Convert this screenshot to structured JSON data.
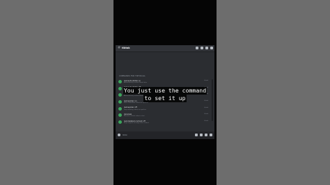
{
  "app": {
    "channel": "tiktok",
    "section_title": "COMMANDS FOR TIKTOK.GG",
    "commands": [
      {
        "name": "/set-auto-tiktok on",
        "desc": "Automatically embed tiktok links",
        "tag": "tiktok"
      },
      {
        "name": "/set-auto-tiktok off",
        "desc": "Stop embedding tiktok links",
        "tag": "tiktok"
      },
      {
        "name": "/set-auto-tiktok on",
        "desc": "Automatically embed tiktok links",
        "tag": "tiktok"
      },
      {
        "name": "/set-spoiler on",
        "desc": "Mark embedded videos as spoilers",
        "tag": "tiktok"
      },
      {
        "name": "/set-spoiler off",
        "desc": "Stop marking videos as spoilers",
        "tag": "tiktok"
      },
      {
        "name": "/preview",
        "desc": "Preview a tiktok video in chat",
        "tag": "tiktok"
      },
      {
        "name": "/set-deleted-content off",
        "desc": "Keep original message after embed",
        "tag": "tiktok"
      }
    ],
    "bottom_label": "tiktok"
  },
  "caption": {
    "line1": "You just use the command",
    "line2": "to set it up"
  },
  "icons": {
    "topbar": [
      "pin-icon",
      "bell-icon",
      "members-icon",
      "search-icon"
    ],
    "bottombar_left": [
      "add-icon"
    ],
    "bottombar_right": [
      "gift-icon",
      "gif-icon",
      "sticker-icon",
      "emoji-icon"
    ]
  },
  "colors": {
    "bot_avatar": "#3ba55c",
    "panel": "#2b2d31",
    "outer": "#6d6d6d"
  }
}
